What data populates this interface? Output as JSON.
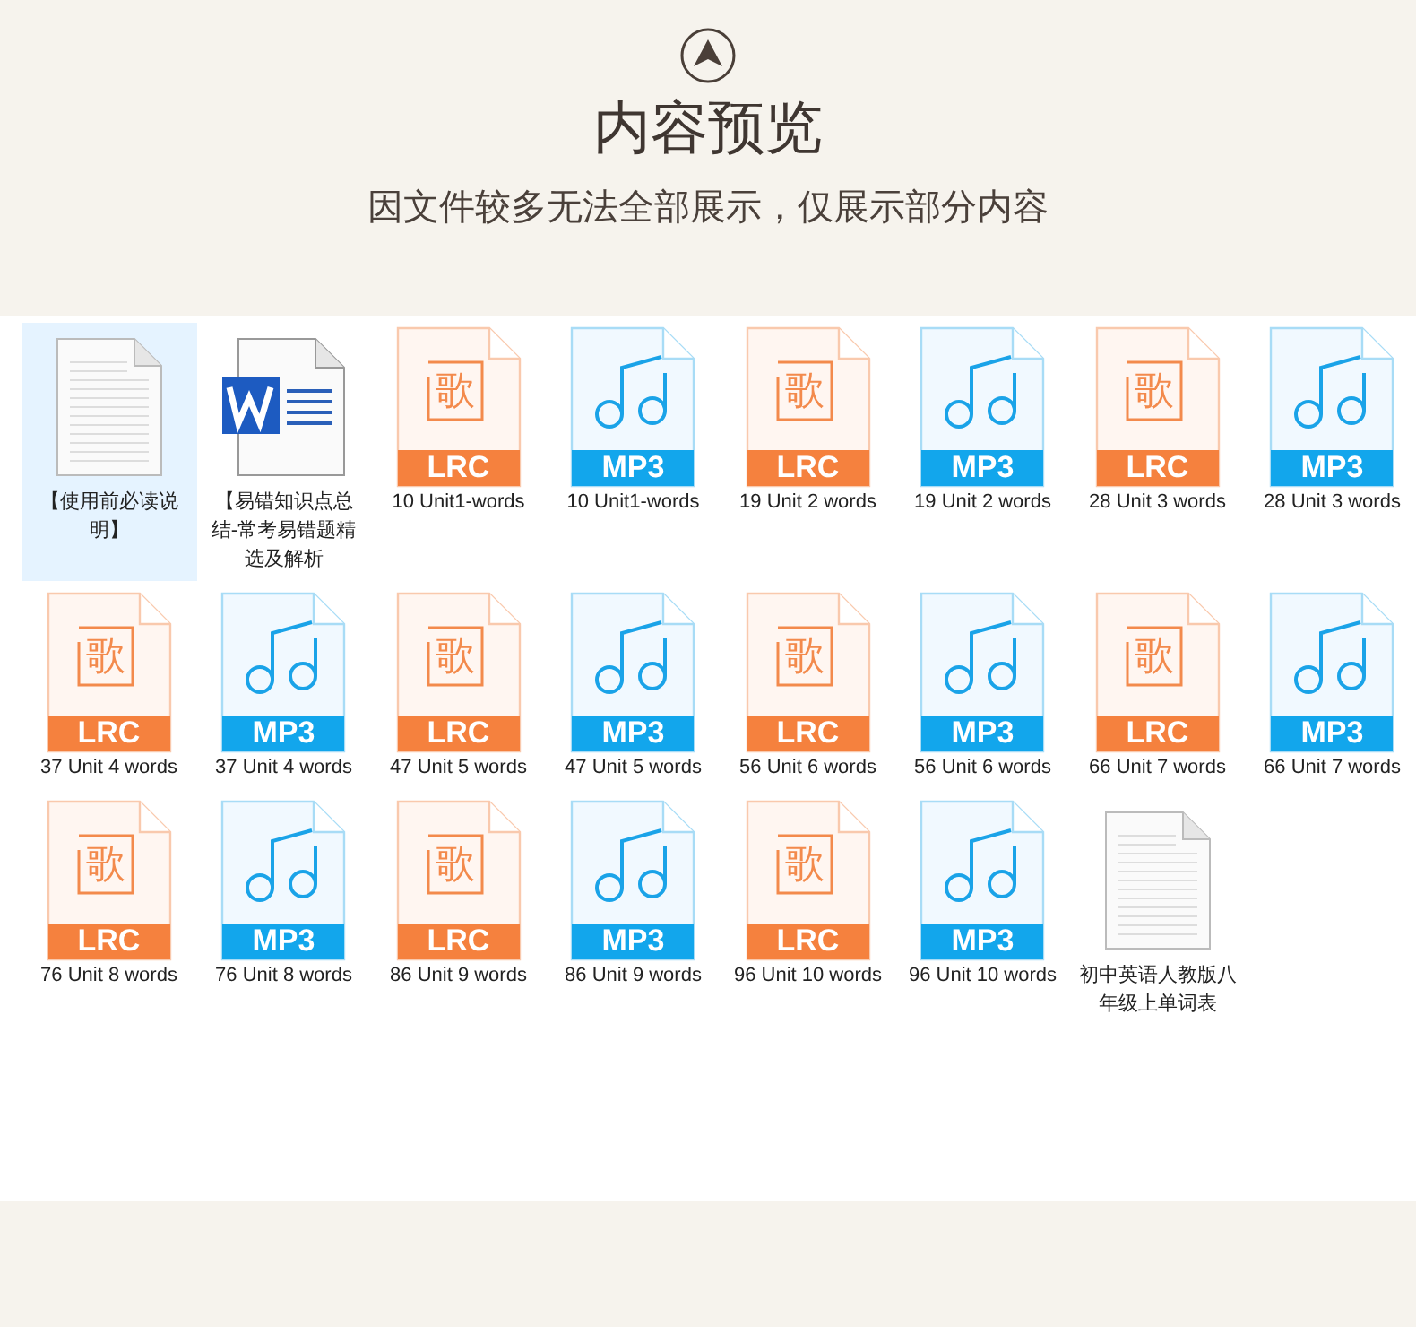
{
  "header": {
    "title": "内容预览",
    "subtitle": "因文件较多无法全部展示，仅展示部分内容"
  },
  "files": [
    {
      "kind": "doc",
      "label": "【使用前必读说明】",
      "selected": true
    },
    {
      "kind": "word",
      "label": "【易错知识点总结-常考易错题精选及解析",
      "selected": false
    },
    {
      "kind": "lrc",
      "glyph": "歌",
      "badge": "LRC",
      "label": "10 Unit1-words",
      "selected": false
    },
    {
      "kind": "mp3",
      "badge": "MP3",
      "label": "10 Unit1-words",
      "selected": false
    },
    {
      "kind": "lrc",
      "glyph": "歌",
      "badge": "LRC",
      "label": "19 Unit 2 words",
      "selected": false
    },
    {
      "kind": "mp3",
      "badge": "MP3",
      "label": "19 Unit 2 words",
      "selected": false
    },
    {
      "kind": "lrc",
      "glyph": "歌",
      "badge": "LRC",
      "label": "28 Unit 3 words",
      "selected": false
    },
    {
      "kind": "mp3",
      "badge": "MP3",
      "label": "28 Unit 3 words",
      "selected": false
    },
    {
      "kind": "lrc",
      "glyph": "歌",
      "badge": "LRC",
      "label": "37 Unit 4 words",
      "selected": false
    },
    {
      "kind": "mp3",
      "badge": "MP3",
      "label": "37 Unit 4 words",
      "selected": false
    },
    {
      "kind": "lrc",
      "glyph": "歌",
      "badge": "LRC",
      "label": "47 Unit 5 words",
      "selected": false
    },
    {
      "kind": "mp3",
      "badge": "MP3",
      "label": "47 Unit 5 words",
      "selected": false
    },
    {
      "kind": "lrc",
      "glyph": "歌",
      "badge": "LRC",
      "label": "56 Unit 6 words",
      "selected": false
    },
    {
      "kind": "mp3",
      "badge": "MP3",
      "label": "56 Unit 6 words",
      "selected": false
    },
    {
      "kind": "lrc",
      "glyph": "歌",
      "badge": "LRC",
      "label": "66 Unit 7 words",
      "selected": false
    },
    {
      "kind": "mp3",
      "badge": "MP3",
      "label": "66 Unit 7 words",
      "selected": false
    },
    {
      "kind": "lrc",
      "glyph": "歌",
      "badge": "LRC",
      "label": "76 Unit 8 words",
      "selected": false
    },
    {
      "kind": "mp3",
      "badge": "MP3",
      "label": "76 Unit 8 words",
      "selected": false
    },
    {
      "kind": "lrc",
      "glyph": "歌",
      "badge": "LRC",
      "label": "86 Unit 9 words",
      "selected": false
    },
    {
      "kind": "mp3",
      "badge": "MP3",
      "label": "86 Unit 9 words",
      "selected": false
    },
    {
      "kind": "lrc",
      "glyph": "歌",
      "badge": "LRC",
      "label": "96 Unit 10 words",
      "selected": false
    },
    {
      "kind": "mp3",
      "badge": "MP3",
      "label": "96 Unit 10 words",
      "selected": false
    },
    {
      "kind": "doc",
      "label": "初中英语人教版八年级上单词表",
      "selected": false
    }
  ]
}
